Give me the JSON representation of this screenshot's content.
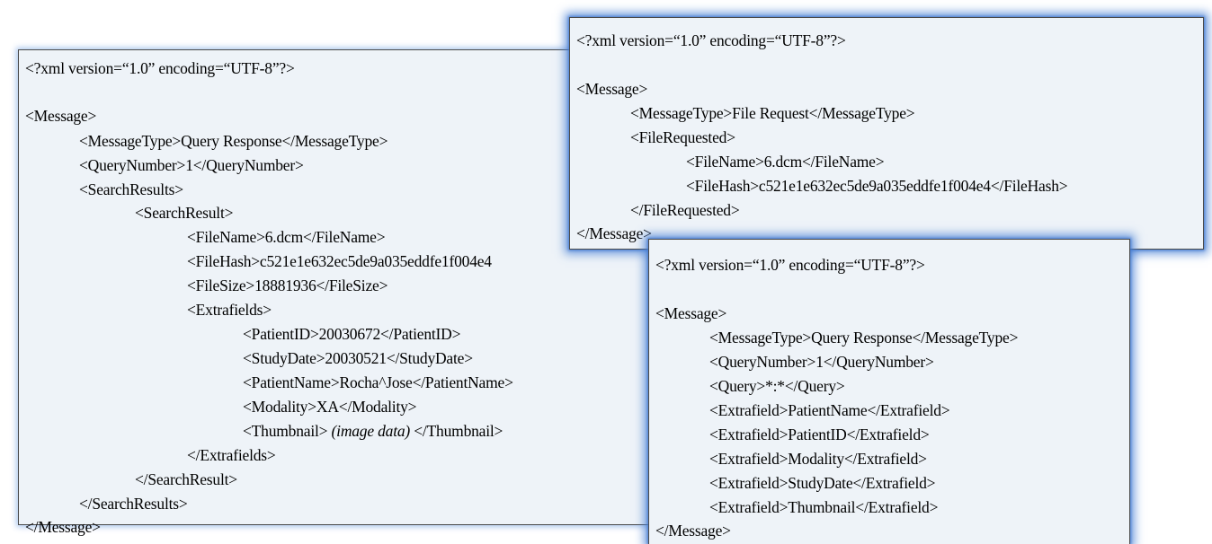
{
  "panels": {
    "query_response_result": {
      "lines": [
        "<?xml version=“1.0” encoding=“UTF-8”?>",
        "<Message>",
        "<MessageType>Query Response</MessageType>",
        "<QueryNumber>1</QueryNumber>",
        "<SearchResults>",
        "<SearchResult>",
        "<FileName>6.dcm</FileName>",
        "<FileHash>c521e1e632ec5de9a035eddfe1f004e4",
        "<FileSize>18881936</FileSize>",
        "<Extrafields>",
        "<PatientID>20030672</PatientID>",
        "<StudyDate>20030521</StudyDate>",
        "<PatientName>Rocha^Jose</PatientName>",
        "<Modality>XA</Modality>",
        "<Thumbnail>",
        "(image data)",
        "</Thumbnail>",
        "</Extrafields>",
        "</SearchResult>",
        "</SearchResults>",
        "</Message>"
      ]
    },
    "file_request": {
      "lines": [
        "<?xml version=“1.0” encoding=“UTF-8”?>",
        "<Message>",
        "<MessageType>File Request</MessageType>",
        "<FileRequested>",
        "<FileName>6.dcm</FileName>",
        "<FileHash>c521e1e632ec5de9a035eddfe1f004e4</FileHash>",
        "</FileRequested>",
        "</Message>"
      ]
    },
    "query_response_fields": {
      "lines": [
        "<?xml version=“1.0” encoding=“UTF-8”?>",
        "<Message>",
        "<MessageType>Query Response</MessageType>",
        "<QueryNumber>1</QueryNumber>",
        "<Query>*:*</Query>",
        "<Extrafield>PatientName</Extrafield>",
        "<Extrafield>PatientID</Extrafield>",
        "<Extrafield>Modality</Extrafield>",
        "<Extrafield>StudyDate</Extrafield>",
        "<Extrafield>Thumbnail</Extrafield>",
        "</Message>"
      ]
    }
  },
  "colors": {
    "panel_background": "#eef3f8",
    "glow": "#4a82d6",
    "border": "#4a4a4a",
    "text": "#000000"
  }
}
